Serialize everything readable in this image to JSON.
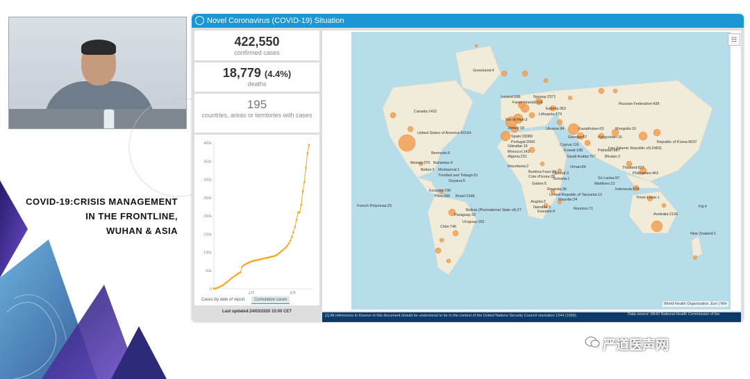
{
  "caption": {
    "line1": "COVID-19:CRISIS MANAGEMENT",
    "line2": "IN THE FRONTLINE,",
    "line3": "WUHAN & ASIA"
  },
  "dashboard": {
    "title": "Novel Coronavirus (COVID-19) Situation",
    "confirmed": {
      "value": "422,550",
      "label": "confirmed cases"
    },
    "deaths": {
      "value": "18,779",
      "pct": "(4.4%)",
      "label": "deaths"
    },
    "countries": {
      "value": "195",
      "label": "countries, areas or territories with cases"
    },
    "tabs": [
      "Cases by date of report",
      "Cumulative cases"
    ],
    "last_updated": "Last updated:24/03/2020 15:00 CET",
    "attribution": "World Health Organization, Esri | WH",
    "footer_note": "[1] All references to Kosovo in this document should be understood to be in the context of the United Nations Security Council resolution 1244 (1999).",
    "data_source": "Data source: WHO National Health Commission of the",
    "map_toolbar": "☷"
  },
  "chart_data": {
    "type": "line",
    "yticks": [
      "0",
      "50k",
      "100k",
      "150k",
      "200k",
      "250k",
      "300k",
      "350k",
      "400k"
    ],
    "xticks": [
      "2月",
      "3月"
    ],
    "values": [
      500,
      1000,
      2000,
      4000,
      6000,
      8000,
      10000,
      14000,
      17000,
      20000,
      24000,
      28000,
      31000,
      34000,
      37000,
      40000,
      43000,
      45000,
      60000,
      64000,
      67000,
      69000,
      71000,
      73000,
      75000,
      76000,
      77000,
      78000,
      79000,
      80000,
      81000,
      82000,
      83000,
      84000,
      85000,
      86000,
      87000,
      88000,
      89000,
      90000,
      92000,
      95000,
      98000,
      102000,
      105000,
      109000,
      113000,
      118000,
      124000,
      132000,
      142000,
      155000,
      170000,
      190000,
      209000,
      210000,
      230000,
      267000,
      292000,
      332000,
      372000,
      395000
    ],
    "ylim": [
      0,
      400000
    ],
    "color": "#f6a623"
  },
  "map_labels": [
    "Greenland:4",
    "Iceland:588",
    "Norway:2371",
    "Faroe Islands:118",
    "Estonia:352",
    "Lithuania:179",
    "Russian Federation:438",
    "Canada:1432",
    "United States of America:42164",
    "Isle of Man:3",
    "Jersey:18",
    "Ukraine:84",
    "Kazakhstan:63",
    "Mongolia:10",
    "Spain:33089",
    "Portugal:2060",
    "Georgia:67",
    "Kyrgyzstan:16",
    "Gibraltar:15",
    "Morocco:143",
    "Cyprus:116",
    "Iran (Islamic Republic of):24811",
    "Republic of Korea:9037",
    "Algeria:231",
    "Kuwait:188",
    "Pakistan:887",
    "Saudi Arabia:767",
    "Bhutan:2",
    "Bermuda:6",
    "Mexico:370",
    "Bahamas:4",
    "Belize:3",
    "Montserrat:1",
    "Trinidad and Tobago:51",
    "Guyana:5",
    "Ecuador:790",
    "Peru:395",
    "Brazil:1546",
    "Mauritania:2",
    "Burkina Faso:99",
    "Cote d'Ivoire:25",
    "Djibouti:3",
    "Somalia:1",
    "Gabon:5",
    "Rwanda:36",
    "United Republic of Tanzania:12",
    "Oman:84",
    "Thailand:827",
    "Philippines:462",
    "Sri Lanka:97",
    "Maldives:13",
    "Indonesia:579",
    "Timor-Leste:1",
    "Mayotte:24",
    "Angola:2",
    "Namibia:3",
    "Eswatini:4",
    "Reunion:71",
    "Bolivia (Plurinational State of):27",
    "Paraguay:22",
    "Uruguay:162",
    "Chile:746",
    "French Polynesia:25",
    "Australia:2136",
    "Fiji:4",
    "New Zealand:1"
  ],
  "brand": "严道医声网"
}
